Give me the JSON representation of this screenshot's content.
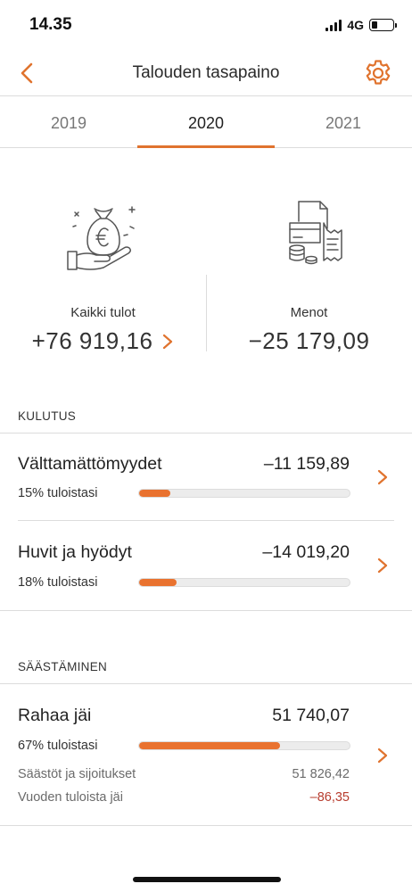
{
  "status_bar": {
    "time": "14.35",
    "network": "4G",
    "signal_bars": 4,
    "battery_level": 0.25
  },
  "nav": {
    "title": "Talouden tasapaino",
    "back_icon": "chevron-left-icon",
    "settings_icon": "gear-icon"
  },
  "year_tabs": [
    {
      "label": "2019",
      "active": false
    },
    {
      "label": "2020",
      "active": true
    },
    {
      "label": "2021",
      "active": false
    }
  ],
  "summary": {
    "income": {
      "label": "Kaikki tulot",
      "value": "+76 919,16",
      "icon": "money-bag-hand-icon"
    },
    "expenses": {
      "label": "Menot",
      "value": "−25 179,09",
      "icon": "bills-coins-icon"
    }
  },
  "kulutus": {
    "header": "KULUTUS",
    "rows": [
      {
        "title": "Välttamättömyydet",
        "amount": "–11 159,89",
        "sub": "15% tuloistasi",
        "percent": 15
      },
      {
        "title": "Huvit ja hyödyt",
        "amount": "–14 019,20",
        "sub": "18% tuloistasi",
        "percent": 18
      }
    ]
  },
  "saastaminen": {
    "header": "SÄÄSTÄMINEN",
    "row": {
      "title": "Rahaa jäi",
      "amount": "51 740,07",
      "sub": "67% tuloistasi",
      "percent": 67,
      "details": [
        {
          "label": "Säästöt ja sijoitukset",
          "value": "51 826,42",
          "negative": false
        },
        {
          "label": "Vuoden tuloista jäi",
          "value": "–86,35",
          "negative": true
        }
      ]
    }
  },
  "colors": {
    "accent": "#e9722f",
    "negative": "#b73c2e",
    "divider": "#dcdcdc"
  }
}
